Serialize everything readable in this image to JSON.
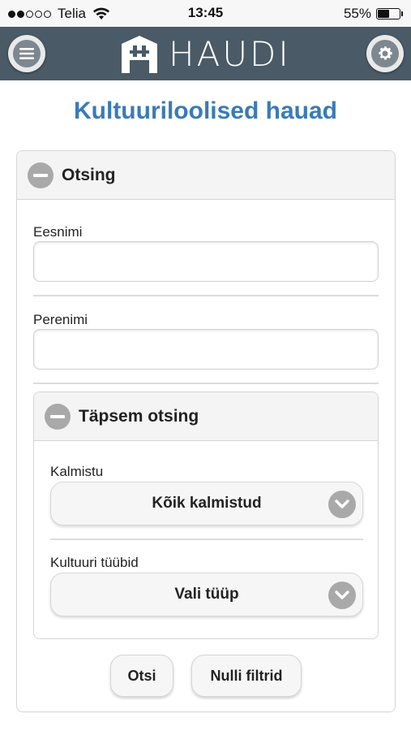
{
  "status_bar": {
    "carrier": "Telia",
    "time": "13:45",
    "battery": "55%",
    "battery_level": 0.55,
    "signal_bars_filled": 2,
    "signal_bars_total": 5
  },
  "header": {
    "logo_text": "HAUDI",
    "background_color": "#4a5a66",
    "menu_icon": "menu-icon",
    "settings_icon": "gear-icon"
  },
  "page": {
    "title": "Kultuuriloolised hauad",
    "title_color": "#3a7ab8"
  },
  "search_panel": {
    "title": "Otsing",
    "first_name_label": "Eesnimi",
    "first_name_value": "",
    "last_name_label": "Perenimi",
    "last_name_value": ""
  },
  "advanced_panel": {
    "title": "Täpsem otsing",
    "cemetery_label": "Kalmistu",
    "cemetery_selected": "Kõik kalmistud",
    "culture_type_label": "Kultuuri tüübid",
    "culture_type_selected": "Vali tüüp"
  },
  "actions": {
    "search_button": "Otsi",
    "reset_button": "Nulli filtrid"
  }
}
